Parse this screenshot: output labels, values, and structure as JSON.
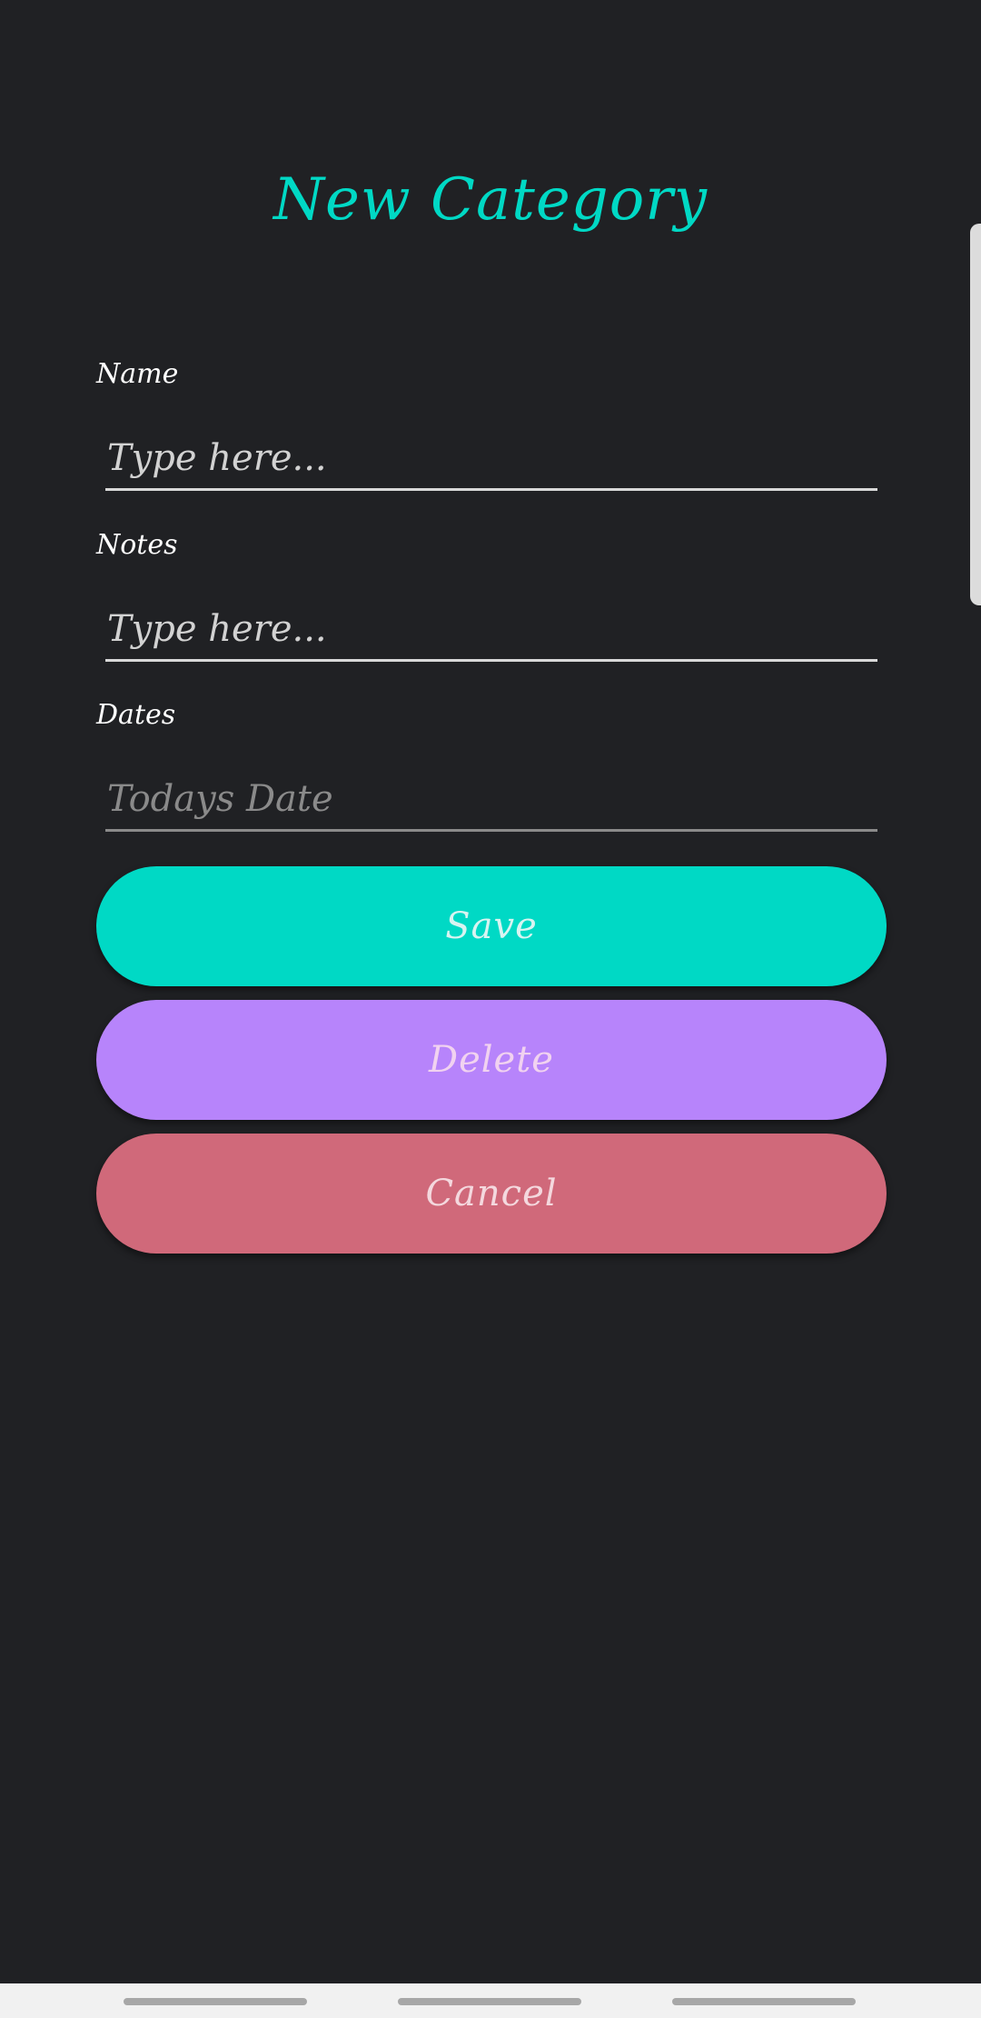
{
  "title": "New Category",
  "colors": {
    "background": "#202124",
    "accent": "#00d9c5",
    "save": "#00d9c5",
    "delete": "#b784fb",
    "cancel": "#d0697a"
  },
  "form": {
    "name": {
      "label": "Name",
      "placeholder": "Type here..."
    },
    "notes": {
      "label": "Notes",
      "placeholder": "Type here..."
    },
    "dates": {
      "label": "Dates",
      "placeholder": "Todays Date"
    }
  },
  "buttons": {
    "save": "Save",
    "delete": "Delete",
    "cancel": "Cancel"
  },
  "navbar": {
    "icons": [
      "nav-pill-left",
      "nav-pill-center",
      "nav-pill-right"
    ]
  }
}
